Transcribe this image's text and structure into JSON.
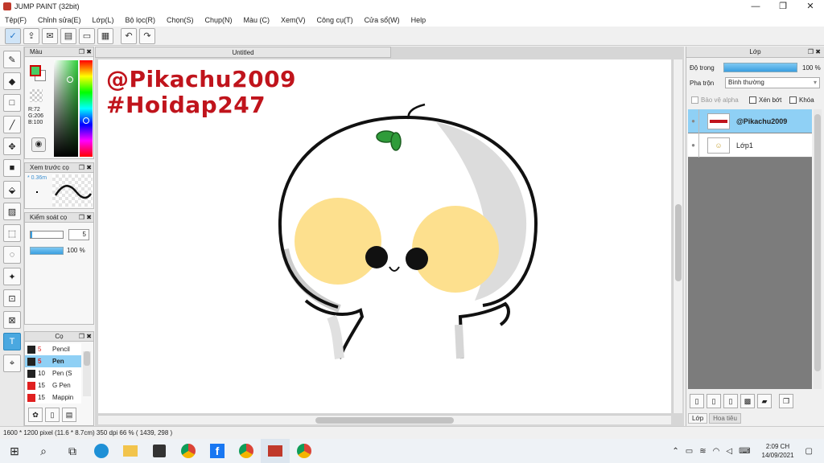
{
  "window": {
    "title": "JUMP PAINT (32bit)",
    "min": "—",
    "max": "❐",
    "close": "✕"
  },
  "menu": [
    "Tệp(F)",
    "Chỉnh sửa(E)",
    "Lớp(L)",
    "Bộ lọc(R)",
    "Chọn(S)",
    "Chụp(N)",
    "Màu (C)",
    "Xem(V)",
    "Công cụ(T)",
    "Cửa sổ(W)",
    "Help"
  ],
  "toolbar": {
    "icons": [
      "check-icon",
      "share-icon",
      "comment-icon",
      "note-icon",
      "page-icon",
      "grid-icon",
      "undo-icon",
      "redo-icon"
    ]
  },
  "panels": {
    "color": {
      "title": "Màu",
      "r": "R:72",
      "g": "G:206",
      "b": "B:100",
      "fg": "#48ce64",
      "bg": "#ffffff"
    },
    "brush_preview": {
      "title": "Xem trước cọ",
      "size": "* 0.36m"
    },
    "brush_control": {
      "title": "Kiểm soát cọ",
      "size": "5",
      "opacity": "100 %"
    },
    "brush_list": {
      "title": "Cọ",
      "items": [
        {
          "size": "5",
          "name": "Pencil",
          "color": "#222222",
          "selected": false
        },
        {
          "size": "5",
          "name": "Pen",
          "color": "#222222",
          "selected": true
        },
        {
          "size": "10",
          "name": "Pen (S",
          "color": "#222222",
          "selected": false
        },
        {
          "size": "15",
          "name": "G Pen",
          "color": "#e02020",
          "selected": false
        },
        {
          "size": "15",
          "name": "Mappin",
          "color": "#e02020",
          "selected": false
        }
      ]
    }
  },
  "document": {
    "tab": "Untitled",
    "watermark1": "@Pikachu2009",
    "watermark2": "#Hoidap247"
  },
  "layers_panel": {
    "title": "Lớp",
    "opacity_label": "Độ trong",
    "opacity_value": "100 %",
    "opacity_level": 1.0,
    "blend_label": "Pha trộn",
    "blend_value": "Bình thường",
    "protect_alpha": "Bảo vệ alpha",
    "clip": "Xén bớt",
    "lock": "Khóa",
    "layers": [
      {
        "name": "@Pikachu2009",
        "selected": true
      },
      {
        "name": "Lớp1",
        "selected": false
      }
    ],
    "tab_layer": "Lớp",
    "tab_pattern": "Hoa tiêu"
  },
  "status": {
    "text": "1600 * 1200 pixel   (11.6 * 8.7cm)   350 dpi   66 %   ( 1439, 298 )"
  },
  "taskbar": {
    "time": "2:09 CH",
    "date": "14/09/2021"
  }
}
